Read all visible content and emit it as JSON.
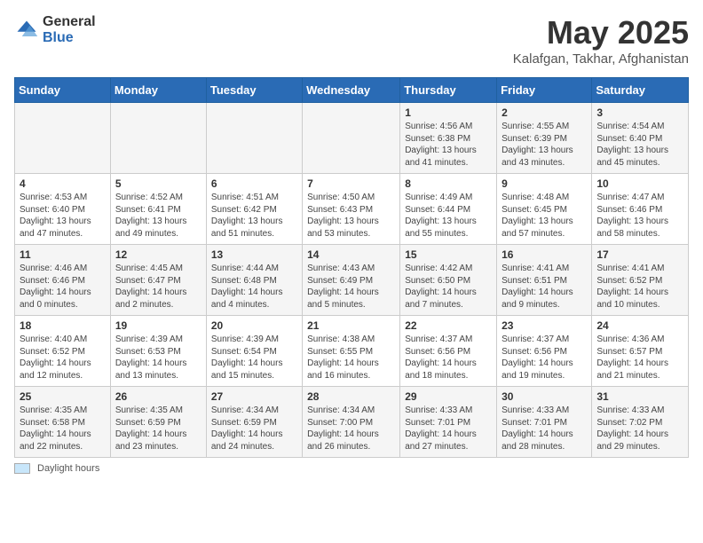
{
  "logo": {
    "general": "General",
    "blue": "Blue"
  },
  "title": {
    "month_year": "May 2025",
    "location": "Kalafgan, Takhar, Afghanistan"
  },
  "days_of_week": [
    "Sunday",
    "Monday",
    "Tuesday",
    "Wednesday",
    "Thursday",
    "Friday",
    "Saturday"
  ],
  "footer": {
    "color_label": "Daylight hours"
  },
  "weeks": [
    [
      {
        "day": "",
        "info": ""
      },
      {
        "day": "",
        "info": ""
      },
      {
        "day": "",
        "info": ""
      },
      {
        "day": "",
        "info": ""
      },
      {
        "day": "1",
        "info": "Sunrise: 4:56 AM\nSunset: 6:38 PM\nDaylight: 13 hours\nand 41 minutes."
      },
      {
        "day": "2",
        "info": "Sunrise: 4:55 AM\nSunset: 6:39 PM\nDaylight: 13 hours\nand 43 minutes."
      },
      {
        "day": "3",
        "info": "Sunrise: 4:54 AM\nSunset: 6:40 PM\nDaylight: 13 hours\nand 45 minutes."
      }
    ],
    [
      {
        "day": "4",
        "info": "Sunrise: 4:53 AM\nSunset: 6:40 PM\nDaylight: 13 hours\nand 47 minutes."
      },
      {
        "day": "5",
        "info": "Sunrise: 4:52 AM\nSunset: 6:41 PM\nDaylight: 13 hours\nand 49 minutes."
      },
      {
        "day": "6",
        "info": "Sunrise: 4:51 AM\nSunset: 6:42 PM\nDaylight: 13 hours\nand 51 minutes."
      },
      {
        "day": "7",
        "info": "Sunrise: 4:50 AM\nSunset: 6:43 PM\nDaylight: 13 hours\nand 53 minutes."
      },
      {
        "day": "8",
        "info": "Sunrise: 4:49 AM\nSunset: 6:44 PM\nDaylight: 13 hours\nand 55 minutes."
      },
      {
        "day": "9",
        "info": "Sunrise: 4:48 AM\nSunset: 6:45 PM\nDaylight: 13 hours\nand 57 minutes."
      },
      {
        "day": "10",
        "info": "Sunrise: 4:47 AM\nSunset: 6:46 PM\nDaylight: 13 hours\nand 58 minutes."
      }
    ],
    [
      {
        "day": "11",
        "info": "Sunrise: 4:46 AM\nSunset: 6:46 PM\nDaylight: 14 hours\nand 0 minutes."
      },
      {
        "day": "12",
        "info": "Sunrise: 4:45 AM\nSunset: 6:47 PM\nDaylight: 14 hours\nand 2 minutes."
      },
      {
        "day": "13",
        "info": "Sunrise: 4:44 AM\nSunset: 6:48 PM\nDaylight: 14 hours\nand 4 minutes."
      },
      {
        "day": "14",
        "info": "Sunrise: 4:43 AM\nSunset: 6:49 PM\nDaylight: 14 hours\nand 5 minutes."
      },
      {
        "day": "15",
        "info": "Sunrise: 4:42 AM\nSunset: 6:50 PM\nDaylight: 14 hours\nand 7 minutes."
      },
      {
        "day": "16",
        "info": "Sunrise: 4:41 AM\nSunset: 6:51 PM\nDaylight: 14 hours\nand 9 minutes."
      },
      {
        "day": "17",
        "info": "Sunrise: 4:41 AM\nSunset: 6:52 PM\nDaylight: 14 hours\nand 10 minutes."
      }
    ],
    [
      {
        "day": "18",
        "info": "Sunrise: 4:40 AM\nSunset: 6:52 PM\nDaylight: 14 hours\nand 12 minutes."
      },
      {
        "day": "19",
        "info": "Sunrise: 4:39 AM\nSunset: 6:53 PM\nDaylight: 14 hours\nand 13 minutes."
      },
      {
        "day": "20",
        "info": "Sunrise: 4:39 AM\nSunset: 6:54 PM\nDaylight: 14 hours\nand 15 minutes."
      },
      {
        "day": "21",
        "info": "Sunrise: 4:38 AM\nSunset: 6:55 PM\nDaylight: 14 hours\nand 16 minutes."
      },
      {
        "day": "22",
        "info": "Sunrise: 4:37 AM\nSunset: 6:56 PM\nDaylight: 14 hours\nand 18 minutes."
      },
      {
        "day": "23",
        "info": "Sunrise: 4:37 AM\nSunset: 6:56 PM\nDaylight: 14 hours\nand 19 minutes."
      },
      {
        "day": "24",
        "info": "Sunrise: 4:36 AM\nSunset: 6:57 PM\nDaylight: 14 hours\nand 21 minutes."
      }
    ],
    [
      {
        "day": "25",
        "info": "Sunrise: 4:35 AM\nSunset: 6:58 PM\nDaylight: 14 hours\nand 22 minutes."
      },
      {
        "day": "26",
        "info": "Sunrise: 4:35 AM\nSunset: 6:59 PM\nDaylight: 14 hours\nand 23 minutes."
      },
      {
        "day": "27",
        "info": "Sunrise: 4:34 AM\nSunset: 6:59 PM\nDaylight: 14 hours\nand 24 minutes."
      },
      {
        "day": "28",
        "info": "Sunrise: 4:34 AM\nSunset: 7:00 PM\nDaylight: 14 hours\nand 26 minutes."
      },
      {
        "day": "29",
        "info": "Sunrise: 4:33 AM\nSunset: 7:01 PM\nDaylight: 14 hours\nand 27 minutes."
      },
      {
        "day": "30",
        "info": "Sunrise: 4:33 AM\nSunset: 7:01 PM\nDaylight: 14 hours\nand 28 minutes."
      },
      {
        "day": "31",
        "info": "Sunrise: 4:33 AM\nSunset: 7:02 PM\nDaylight: 14 hours\nand 29 minutes."
      }
    ]
  ]
}
